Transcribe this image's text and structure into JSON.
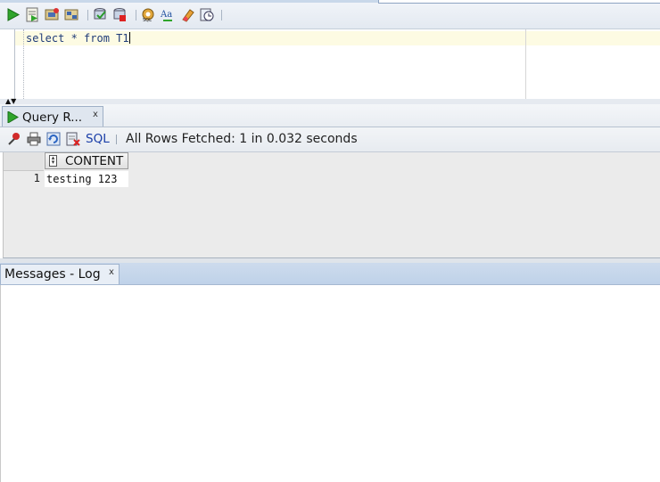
{
  "editor": {
    "sql_text": "select * from T1"
  },
  "query_result": {
    "tab_label": "Query R...",
    "tab_close": "x",
    "sql_label": "SQL",
    "status": "All Rows Fetched: 1 in 0.032 seconds",
    "columns": [
      "CONTENT"
    ],
    "rows": [
      {
        "num": "1",
        "content": "testing 123"
      }
    ]
  },
  "messages": {
    "tab_label": "Messages - Log",
    "tab_close": "x"
  },
  "colors": {
    "accent_blue": "#1a3ea8",
    "run_green": "#2d9b2a",
    "editor_line_highlight": "#fdfbe3"
  },
  "icons": {
    "toolbar": [
      "run-statement-icon",
      "run-script-icon",
      "autotrace-icon",
      "explain-plan-icon",
      "commit-icon",
      "rollback-icon",
      "sql-tuning-icon",
      "format-icon",
      "clear-icon",
      "history-icon"
    ],
    "result_toolbar": [
      "pin-icon",
      "print-icon",
      "refresh-icon",
      "export-icon"
    ]
  }
}
